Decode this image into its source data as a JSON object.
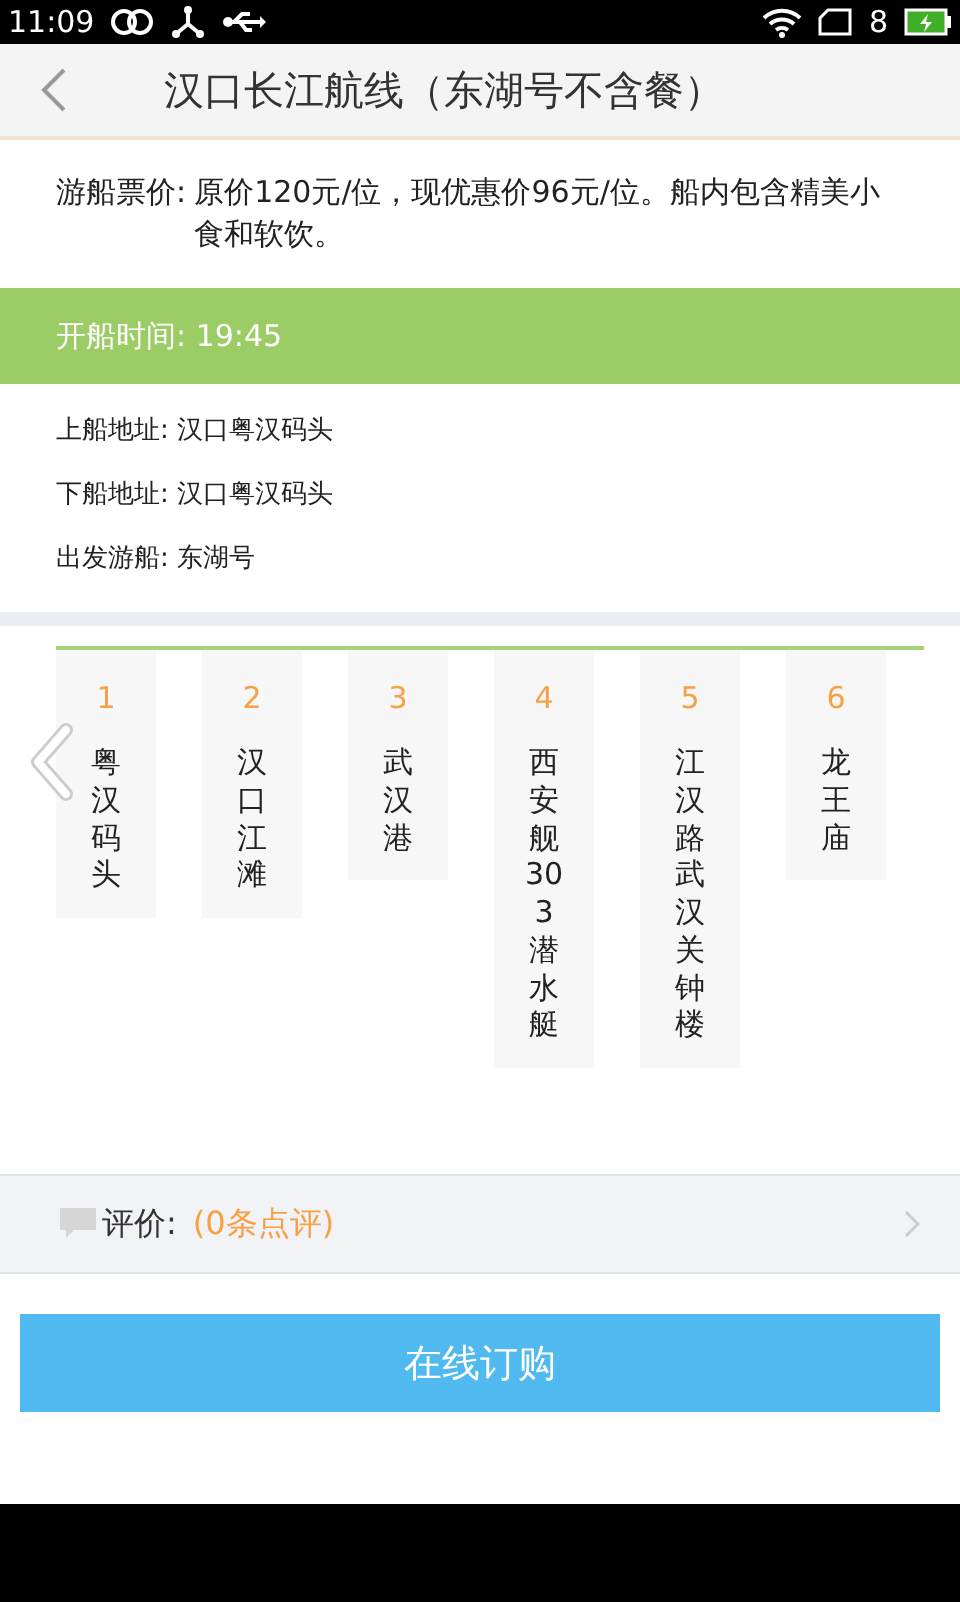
{
  "status_bar": {
    "time": "11:09",
    "badge": "8"
  },
  "header": {
    "title": "汉口长江航线（东湖号不含餐）"
  },
  "price": {
    "label": "游船票价:",
    "value": "原价120元/位，现优惠价96元/位。船内包含精美小食和软饮。"
  },
  "departure": {
    "text": "开船时间: 19:45"
  },
  "info": [
    {
      "text": "上船地址: 汉口粤汉码头"
    },
    {
      "text": "下船地址: 汉口粤汉码头"
    },
    {
      "text": "出发游船: 东湖号"
    }
  ],
  "stops": [
    {
      "number": "1",
      "name": "粤汉码头"
    },
    {
      "number": "2",
      "name": "汉口江滩"
    },
    {
      "number": "3",
      "name": "武汉港"
    },
    {
      "number": "4",
      "name": "西安舰303潜水艇"
    },
    {
      "number": "5",
      "name": "江汉路武汉关钟楼"
    },
    {
      "number": "6",
      "name": "龙王庙"
    }
  ],
  "review": {
    "label": "评价:",
    "count": "(0条点评)"
  },
  "order_button": {
    "label": "在线订购"
  }
}
